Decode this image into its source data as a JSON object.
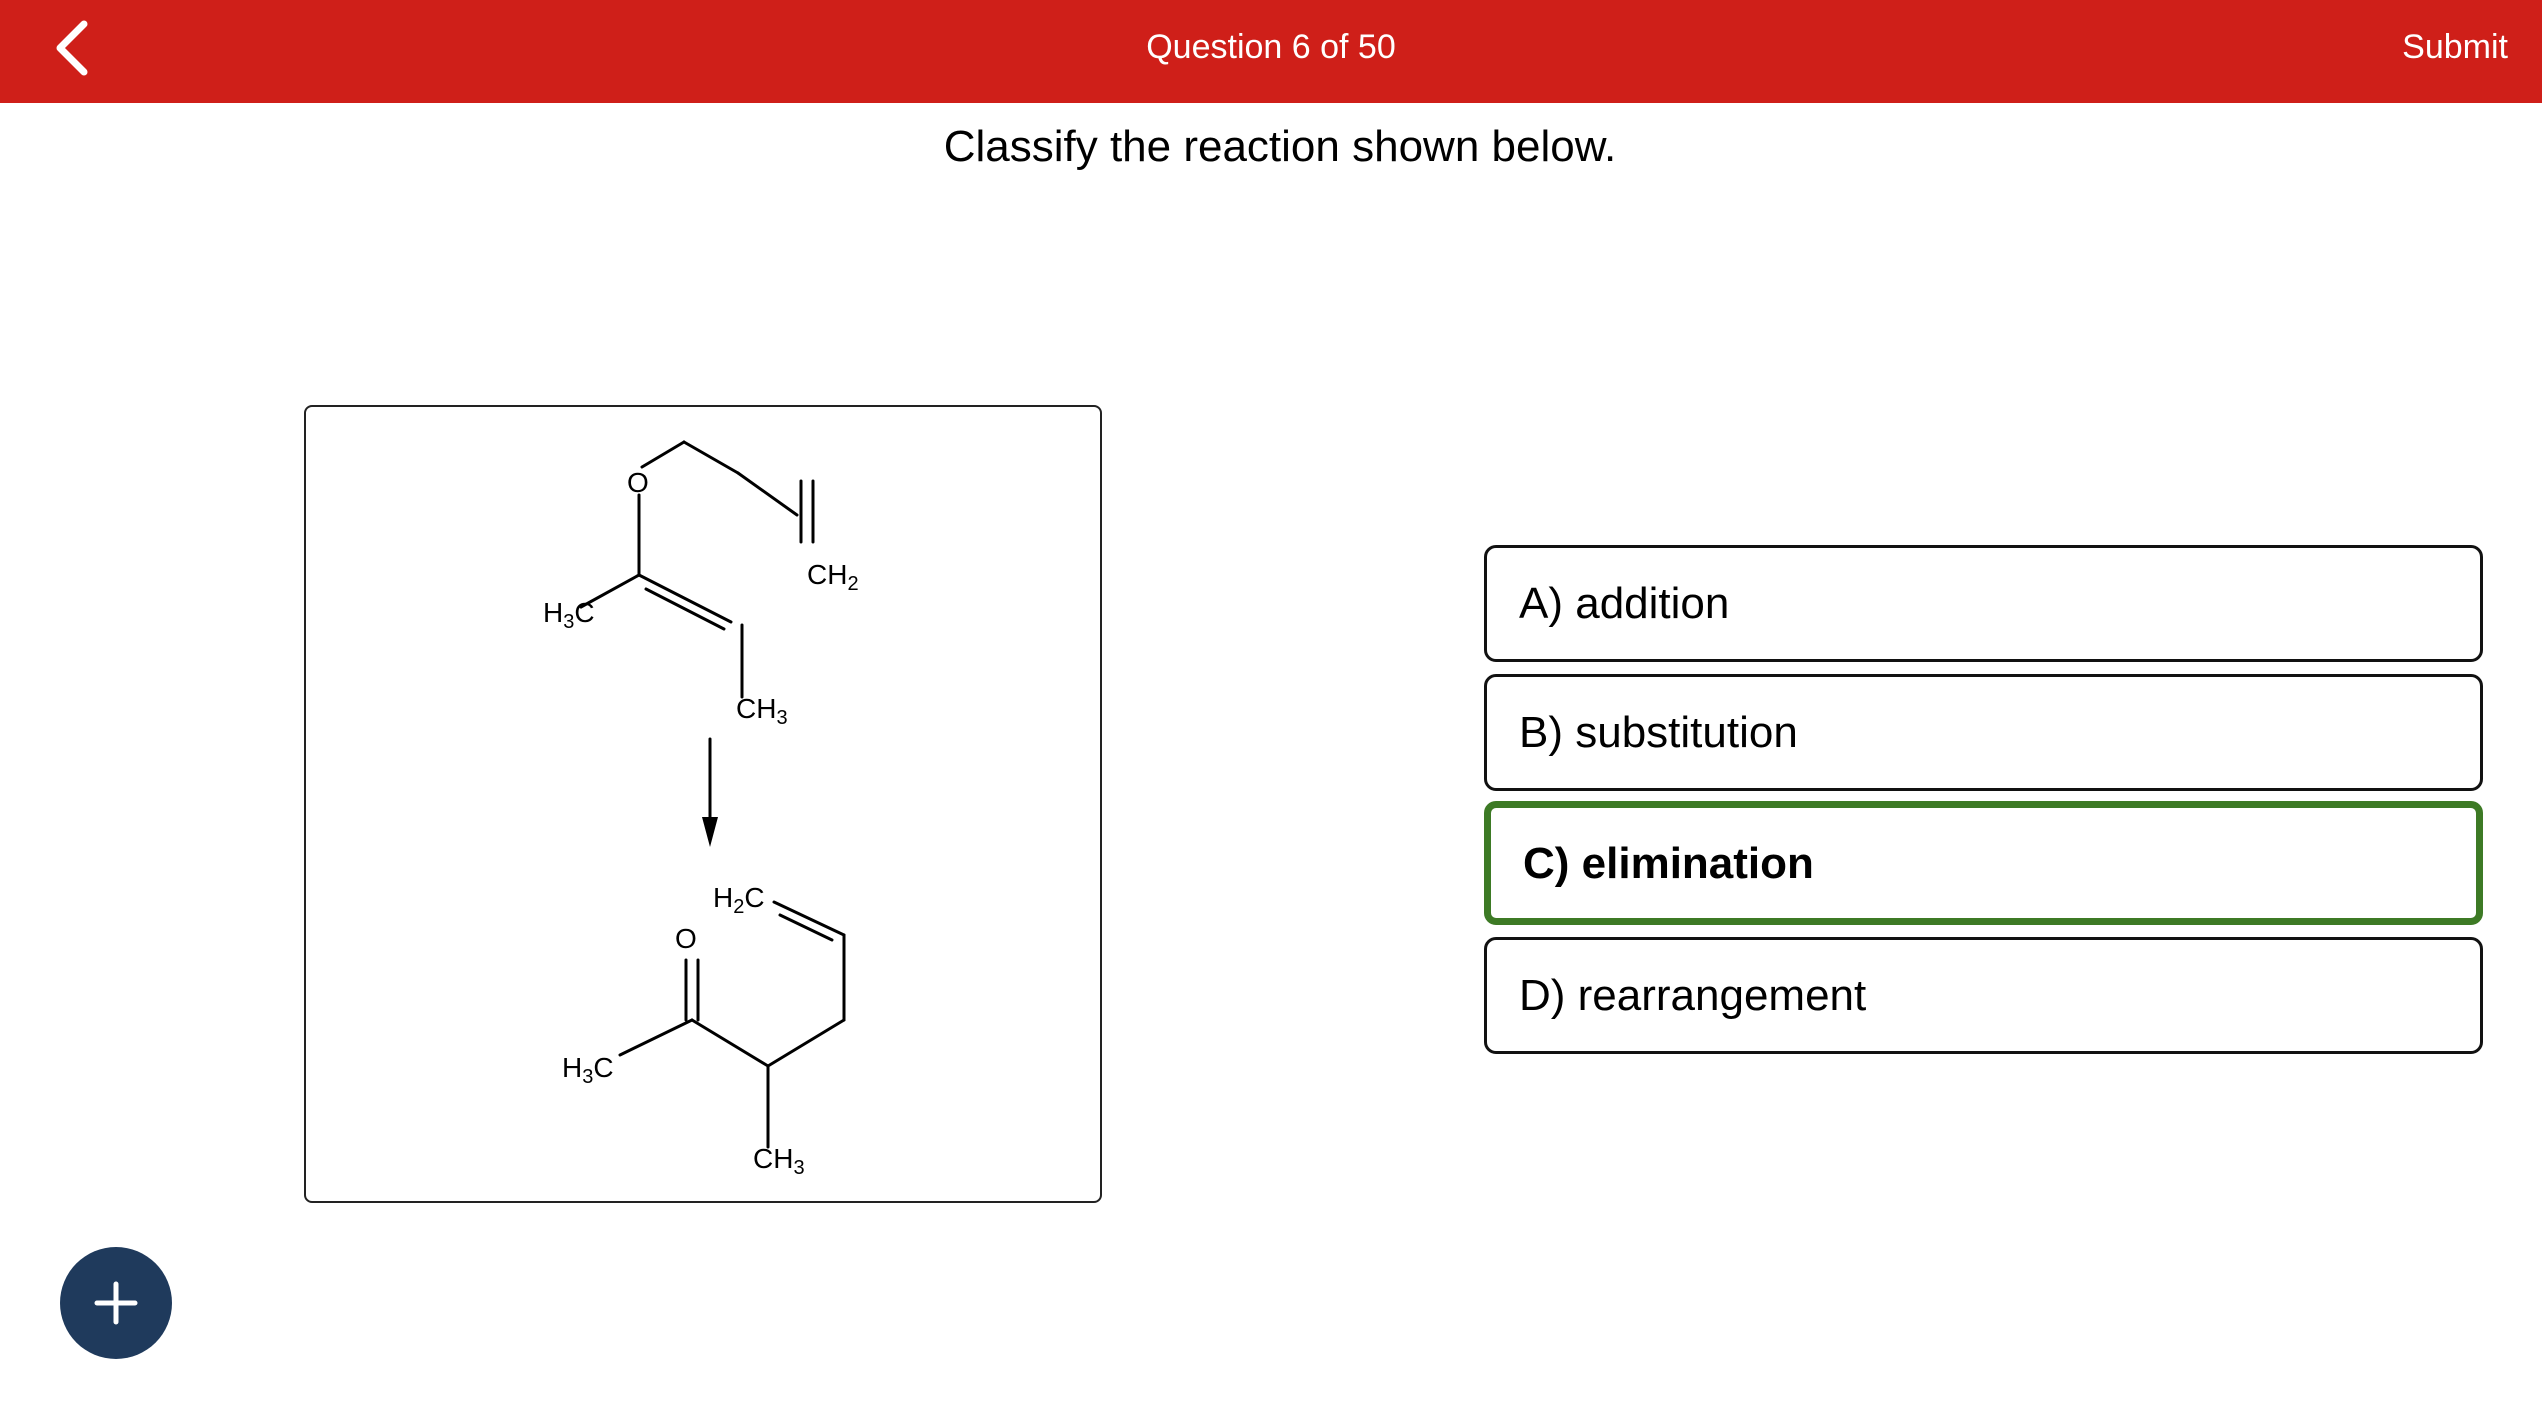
{
  "header": {
    "question_counter": "Question 6 of 50",
    "submit_label": "Submit",
    "bar_color": "#cf1f19",
    "back_icon": "chevron-left-icon"
  },
  "question": {
    "prompt": "Classify the reaction shown below."
  },
  "figure": {
    "reactant_labels": {
      "o": "O",
      "ch2": "CH2",
      "h3c": "H3C",
      "ch3": "CH3"
    },
    "product_labels": {
      "o": "O",
      "h2c": "H2C",
      "h3c": "H3C",
      "ch3": "CH3"
    }
  },
  "options": [
    {
      "label": "A) addition",
      "selected": false
    },
    {
      "label": "B) substitution",
      "selected": false
    },
    {
      "label": "C) elimination",
      "selected": true
    },
    {
      "label": "D) rearrangement",
      "selected": false
    }
  ],
  "selected_color": "#3d7a25",
  "fab": {
    "icon": "plus-icon",
    "color": "#1f3a5c"
  }
}
